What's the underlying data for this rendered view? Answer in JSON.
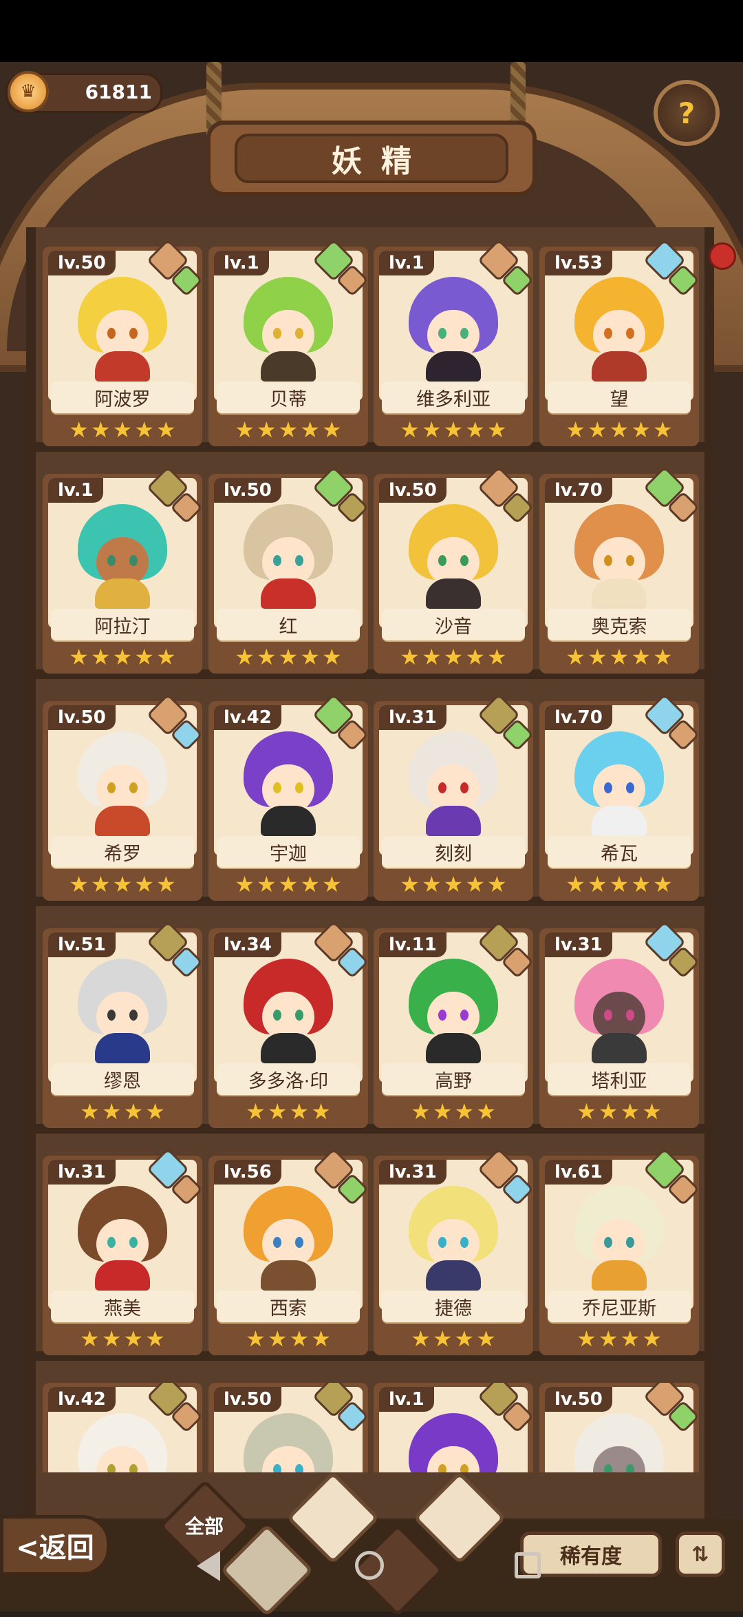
{
  "status": {
    "coins": "61811"
  },
  "header": {
    "title": "妖精"
  },
  "colors": {
    "earth": "#d9a070",
    "leaf": "#8fd26a",
    "water": "#8fd4ea",
    "rock": "#b5a055",
    "star": "#f6c236"
  },
  "cards": [
    {
      "level": "lv.50",
      "name": "阿波罗",
      "stars": 5,
      "elements": [
        "earth-icon",
        "leaf-icon"
      ],
      "hair": "#f4d040",
      "skin": "#ffe4cc",
      "eye": "#c8651c",
      "outfit": "#c23a2a"
    },
    {
      "level": "lv.1",
      "name": "贝蒂",
      "stars": 5,
      "elements": [
        "leaf-icon",
        "earth-icon"
      ],
      "hair": "#8fd24a",
      "skin": "#ffe4cc",
      "eye": "#e0b030",
      "outfit": "#4a3a2a"
    },
    {
      "level": "lv.1",
      "name": "维多利亚",
      "stars": 5,
      "elements": [
        "earth-icon",
        "leaf-icon"
      ],
      "hair": "#7a5ad0",
      "skin": "#ffe4cc",
      "eye": "#4ab07a",
      "outfit": "#2e2430"
    },
    {
      "level": "lv.53",
      "name": "望",
      "stars": 5,
      "elements": [
        "water-icon",
        "leaf-icon"
      ],
      "hair": "#f5b430",
      "skin": "#ffe4cc",
      "eye": "#d07020",
      "outfit": "#b03a2a"
    },
    {
      "level": "lv.1",
      "name": "阿拉汀",
      "stars": 5,
      "elements": [
        "rock-icon",
        "earth-icon"
      ],
      "hair": "#3cc4b0",
      "skin": "#c07a4a",
      "eye": "#3a8a6a",
      "outfit": "#e0b040"
    },
    {
      "level": "lv.50",
      "name": "红",
      "stars": 5,
      "elements": [
        "leaf-icon",
        "rock-icon"
      ],
      "hair": "#d8c4a0",
      "skin": "#ffe4cc",
      "eye": "#3aa09a",
      "outfit": "#c9302a"
    },
    {
      "level": "lv.50",
      "name": "沙音",
      "stars": 5,
      "elements": [
        "earth-icon",
        "rock-icon"
      ],
      "hair": "#f2c23a",
      "skin": "#ffe4cc",
      "eye": "#3a9a5a",
      "outfit": "#3a3030"
    },
    {
      "level": "lv.70",
      "name": "奥克索",
      "stars": 5,
      "elements": [
        "leaf-icon",
        "earth-icon"
      ],
      "hair": "#e0904a",
      "skin": "#ffe4cc",
      "eye": "#d09020",
      "outfit": "#f0e0c0"
    },
    {
      "level": "lv.50",
      "name": "希罗",
      "stars": 5,
      "elements": [
        "earth-icon",
        "water-icon"
      ],
      "hair": "#f0ece4",
      "skin": "#ffe4cc",
      "eye": "#d0a020",
      "outfit": "#c84a2a"
    },
    {
      "level": "lv.42",
      "name": "宇迦",
      "stars": 5,
      "elements": [
        "leaf-icon",
        "earth-icon"
      ],
      "hair": "#7a40c8",
      "skin": "#ffe4cc",
      "eye": "#e0c020",
      "outfit": "#2a2a2a"
    },
    {
      "level": "lv.31",
      "name": "刻刻",
      "stars": 5,
      "elements": [
        "rock-icon",
        "leaf-icon"
      ],
      "hair": "#ece6de",
      "skin": "#ffe4cc",
      "eye": "#c82a2a",
      "outfit": "#6a3ab0"
    },
    {
      "level": "lv.70",
      "name": "希瓦",
      "stars": 5,
      "elements": [
        "water-icon",
        "earth-icon"
      ],
      "hair": "#6ad0ee",
      "skin": "#ffe4cc",
      "eye": "#3a6ad0",
      "outfit": "#f0f0f0"
    },
    {
      "level": "lv.51",
      "name": "缪恩",
      "stars": 4,
      "elements": [
        "rock-icon",
        "water-icon"
      ],
      "hair": "#d8d8d8",
      "skin": "#ffe4cc",
      "eye": "#3a3a3a",
      "outfit": "#2a3a8a"
    },
    {
      "level": "lv.34",
      "name": "多多洛·印",
      "stars": 4,
      "elements": [
        "earth-icon",
        "water-icon"
      ],
      "hair": "#c82a2a",
      "skin": "#ffe4cc",
      "eye": "#3a9a6a",
      "outfit": "#2a2a2a"
    },
    {
      "level": "lv.11",
      "name": "高野",
      "stars": 4,
      "elements": [
        "rock-icon",
        "earth-icon"
      ],
      "hair": "#3ab04a",
      "skin": "#ffe4cc",
      "eye": "#9a3ad0",
      "outfit": "#2a2a2a"
    },
    {
      "level": "lv.31",
      "name": "塔利亚",
      "stars": 4,
      "elements": [
        "water-icon",
        "rock-icon"
      ],
      "hair": "#f08ab0",
      "skin": "#6a4a4a",
      "eye": "#d04a8a",
      "outfit": "#3a3a3a"
    },
    {
      "level": "lv.31",
      "name": "燕美",
      "stars": 4,
      "elements": [
        "water-icon",
        "earth-icon"
      ],
      "hair": "#7a4a2a",
      "skin": "#ffe4cc",
      "eye": "#3ab0a0",
      "outfit": "#c82a2a"
    },
    {
      "level": "lv.56",
      "name": "西索",
      "stars": 4,
      "elements": [
        "earth-icon",
        "leaf-icon"
      ],
      "hair": "#f0a030",
      "skin": "#ffe4cc",
      "eye": "#3a80c0",
      "outfit": "#7a5030"
    },
    {
      "level": "lv.31",
      "name": "捷德",
      "stars": 4,
      "elements": [
        "earth-icon",
        "water-icon"
      ],
      "hair": "#f2e07a",
      "skin": "#ffe4cc",
      "eye": "#3ab0c8",
      "outfit": "#3a3a6a"
    },
    {
      "level": "lv.61",
      "name": "乔尼亚斯",
      "stars": 4,
      "elements": [
        "leaf-icon",
        "earth-icon"
      ],
      "hair": "#f0ecd0",
      "skin": "#ffe4cc",
      "eye": "#3a9a9a",
      "outfit": "#e8a030"
    },
    {
      "level": "lv.42",
      "name": "",
      "stars": 0,
      "elements": [
        "rock-icon",
        "earth-icon"
      ],
      "hair": "#f4f0e8",
      "skin": "#ffe4cc",
      "eye": "#b0a030",
      "outfit": "#e0d8c8"
    },
    {
      "level": "lv.50",
      "name": "",
      "stars": 0,
      "elements": [
        "rock-icon",
        "water-icon"
      ],
      "hair": "#c8c8b0",
      "skin": "#ffe4cc",
      "eye": "#3ab0c8",
      "outfit": "#6a9ac0"
    },
    {
      "level": "lv.1",
      "name": "",
      "stars": 0,
      "elements": [
        "rock-icon",
        "earth-icon"
      ],
      "hair": "#7a3ac8",
      "skin": "#ffe4cc",
      "eye": "#d0a020",
      "outfit": "#6a3ab0"
    },
    {
      "level": "lv.50",
      "name": "",
      "stars": 0,
      "elements": [
        "earth-icon",
        "leaf-icon"
      ],
      "hair": "#f0ece4",
      "skin": "#9a8a8a",
      "eye": "#3a9a6a",
      "outfit": "#8a6a3a"
    }
  ],
  "footer": {
    "back_label": "<返回",
    "filter_all": "全部",
    "rarity_label": "稀有度",
    "sort_icon": "sort-icon"
  }
}
